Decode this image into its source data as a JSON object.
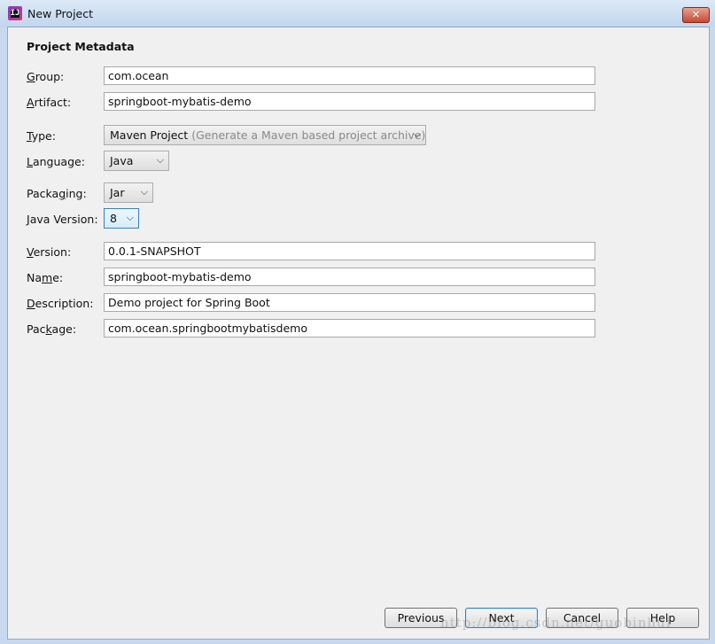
{
  "window": {
    "title": "New Project",
    "app_icon_text": "IJ",
    "close_glyph": "✕"
  },
  "section_title": "Project Metadata",
  "fields": {
    "group": {
      "label_pre": "",
      "label_ul": "G",
      "label_post": "roup:",
      "value": "com.ocean"
    },
    "artifact": {
      "label_pre": "",
      "label_ul": "A",
      "label_post": "rtifact:",
      "value": "springboot-mybatis-demo"
    },
    "version": {
      "label_pre": "",
      "label_ul": "V",
      "label_post": "ersion:",
      "value": "0.0.1-SNAPSHOT"
    },
    "name": {
      "label_pre": "Na",
      "label_ul": "m",
      "label_post": "e:",
      "value": "springboot-mybatis-demo"
    },
    "description": {
      "label_pre": "",
      "label_ul": "D",
      "label_post": "escription:",
      "value": "Demo project for Spring Boot"
    },
    "package": {
      "label_pre": "Pac",
      "label_ul": "k",
      "label_post": "age:",
      "value": "com.ocean.springbootmybatisdemo"
    }
  },
  "selects": {
    "type": {
      "label_pre": "",
      "label_ul": "T",
      "label_post": "ype:",
      "value": "Maven Project",
      "hint": "(Generate a Maven based project archive)"
    },
    "language": {
      "label_pre": "",
      "label_ul": "L",
      "label_post": "anguage:",
      "value": "Java"
    },
    "packaging": {
      "label_pre": "Packa",
      "label_ul": "g",
      "label_post": "ing:",
      "value": "Jar"
    },
    "java_version": {
      "label_pre": "",
      "label_ul": "J",
      "label_post": "ava Version:",
      "value": "8"
    }
  },
  "chevron_glyph": "⌵",
  "buttons": {
    "previous": "Previous",
    "next": "Next",
    "cancel": "Cancel",
    "help": "Help"
  },
  "watermark": "http://blog.csdn.net/guobinhui",
  "colors": {
    "accent_focus": "#3c7fb1",
    "close_red": "#c24a35",
    "titlebar": "#c2d6ed"
  }
}
